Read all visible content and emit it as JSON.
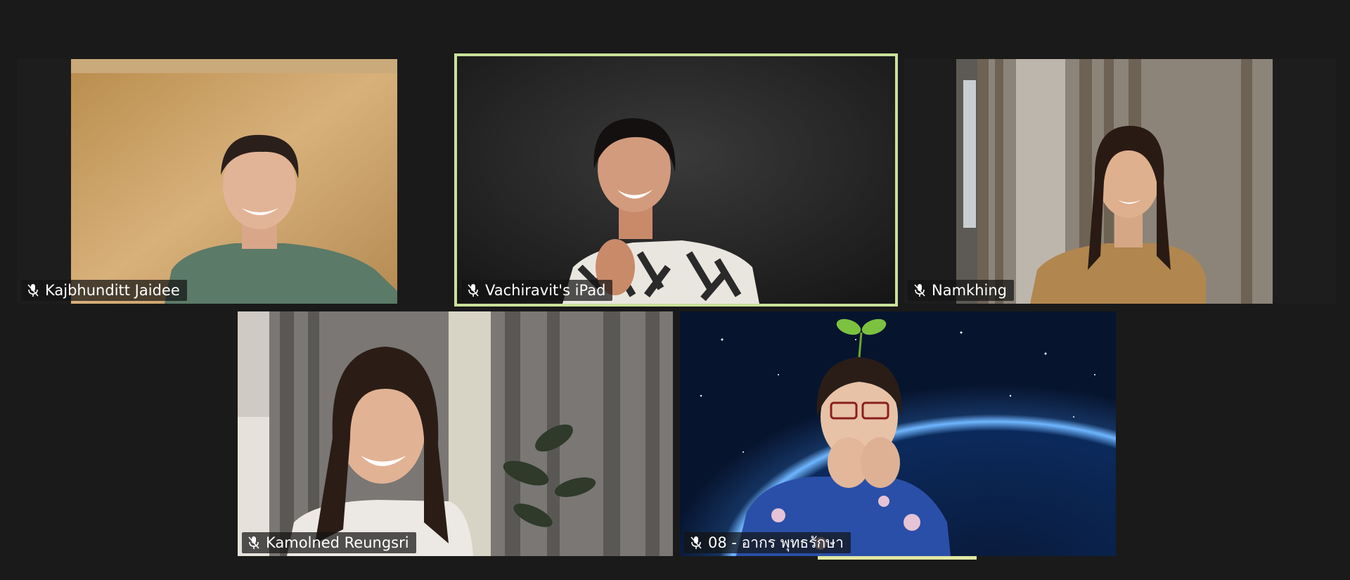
{
  "meeting": {
    "colors": {
      "background": "#1a1a1a",
      "active_speaker_border": "#c9e29a",
      "nameplate_bg": "rgba(20,20,20,0.72)",
      "nameplate_text": "#ffffff"
    },
    "participants": [
      {
        "name": "Kajbhunditt Jaidee",
        "icon": "muted-mic-icon",
        "active": false,
        "scene": "warm-wall"
      },
      {
        "name": "Vachiravit's iPad",
        "icon": "muted-mic-icon",
        "active": true,
        "scene": "dark-backdrop"
      },
      {
        "name": "Namkhing",
        "icon": "muted-mic-icon",
        "active": false,
        "scene": "curtain-room"
      },
      {
        "name": "Kamolned Reungsri",
        "icon": "muted-mic-icon",
        "active": false,
        "scene": "curtain-plant"
      },
      {
        "name": "08 - อากร พุทธรักษา",
        "icon": "muted-mic-icon",
        "active": false,
        "scene": "earth-space"
      }
    ]
  }
}
